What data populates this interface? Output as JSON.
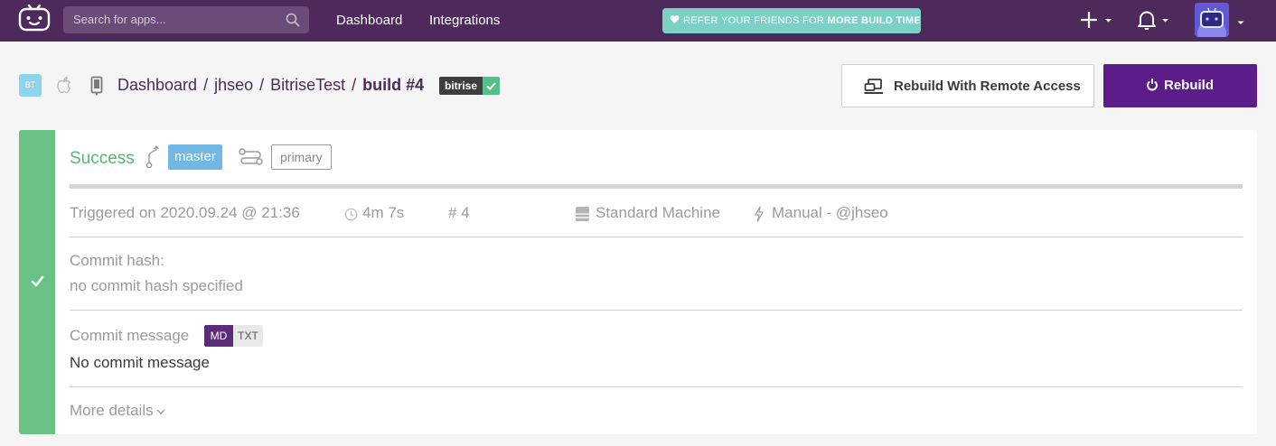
{
  "topbar": {
    "search_placeholder": "Search for apps...",
    "nav": [
      "Dashboard",
      "Integrations"
    ],
    "refer_prefix": "REFER YOUR FRIENDS FOR",
    "refer_strong": "MORE BUILD TIME"
  },
  "header": {
    "app_initials": "BT",
    "breadcrumb": [
      "Dashboard",
      "jhseo",
      "BitriseTest"
    ],
    "separator": "/",
    "current": "build #4",
    "workflow_tag": "bitrise",
    "rebuild_remote_label": "Rebuild With Remote Access",
    "rebuild_label": "Rebuild"
  },
  "build": {
    "status": "Success",
    "branch": "master",
    "workflow": "primary",
    "triggered": "Triggered on 2020.09.24 @ 21:36",
    "duration": "4m 7s",
    "number": "# 4",
    "machine": "Standard Machine",
    "trigger_by": "Manual - @jhseo",
    "commit_hash_label": "Commit hash:",
    "commit_hash_value": "no commit hash specified",
    "commit_message_label": "Commit message",
    "format_md": "MD",
    "format_txt": "TXT",
    "commit_message_value": "No commit message",
    "more_details": "More details"
  },
  "colors": {
    "topbar": "#4e2a5c",
    "success": "#6bc287",
    "branch": "#72b8e4",
    "rebuild": "#5c1d8a",
    "refer": "#7bd1c5"
  }
}
